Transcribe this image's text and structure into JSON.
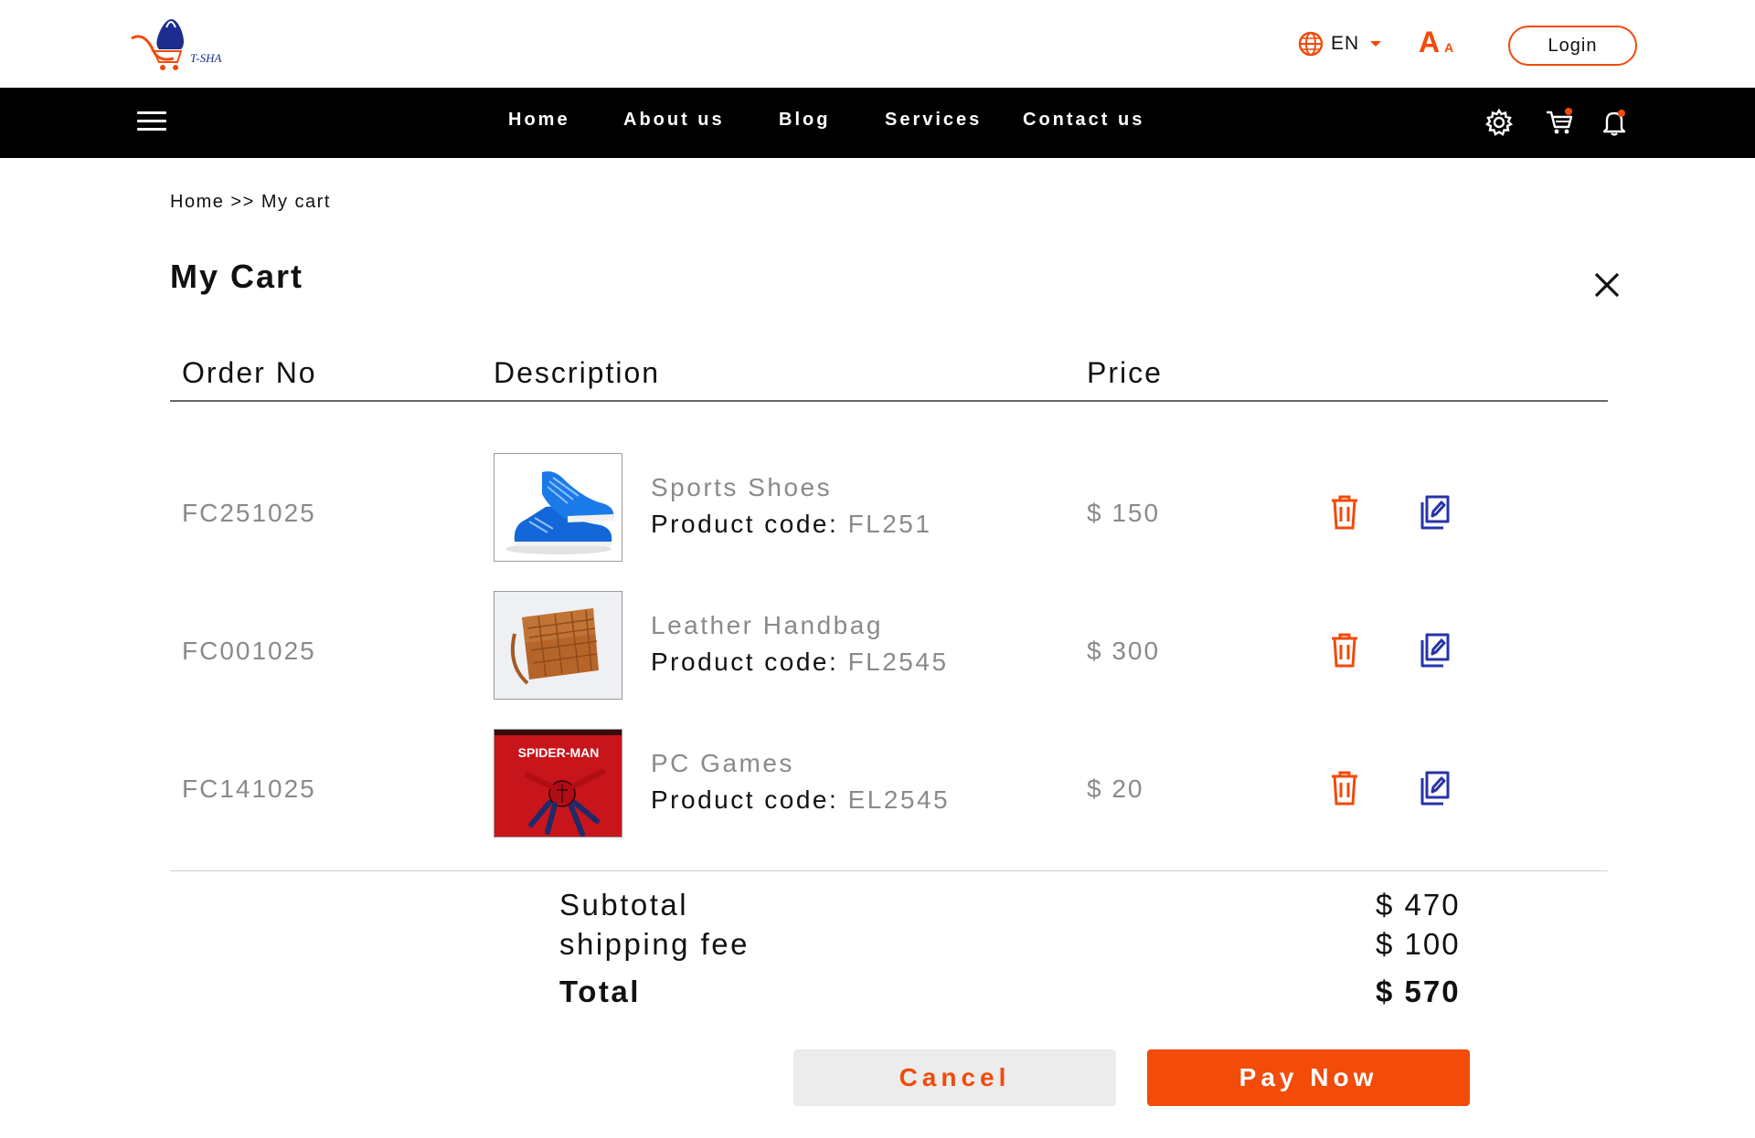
{
  "header": {
    "language": "EN",
    "font_size_large": "A",
    "font_size_small": "A",
    "login_label": "Login"
  },
  "nav": {
    "items": [
      {
        "label": "Home"
      },
      {
        "label": "About us"
      },
      {
        "label": "Blog"
      },
      {
        "label": "Services"
      },
      {
        "label": "Contact us"
      }
    ]
  },
  "breadcrumb": {
    "home": "Home",
    "separator": ">>",
    "current": "My cart"
  },
  "page_title": "My Cart",
  "table": {
    "headers": [
      "Order No",
      "Description",
      "Price"
    ],
    "code_prefix": "Product code: ",
    "rows": [
      {
        "order_no": "FC251025",
        "name": "Sports Shoes",
        "code": "FL251",
        "price": "$ 150",
        "image": "sports-shoes"
      },
      {
        "order_no": "FC001025",
        "name": "Leather Handbag",
        "code": "FL2545",
        "price": "$ 300",
        "image": "leather-handbag"
      },
      {
        "order_no": "FC141025",
        "name": "PC Games",
        "code": "EL2545",
        "price": "$ 20",
        "image": "spider-man-game"
      }
    ]
  },
  "summary": {
    "subtotal_label": "Subtotal",
    "subtotal_value": "$ 470",
    "shipping_label": "shipping fee",
    "shipping_value": "$ 100",
    "total_label": "Total",
    "total_value": "$ 570"
  },
  "actions": {
    "cancel_label": "Cancel",
    "pay_label": "Pay Now"
  },
  "game_cover_text": "SPIDER-MAN",
  "logo_text": "T-SHA",
  "colors": {
    "accent": "#f24b0a",
    "nav_bg": "#000000",
    "edit_icon": "#2634a8",
    "muted_text": "#8a8a8a"
  }
}
